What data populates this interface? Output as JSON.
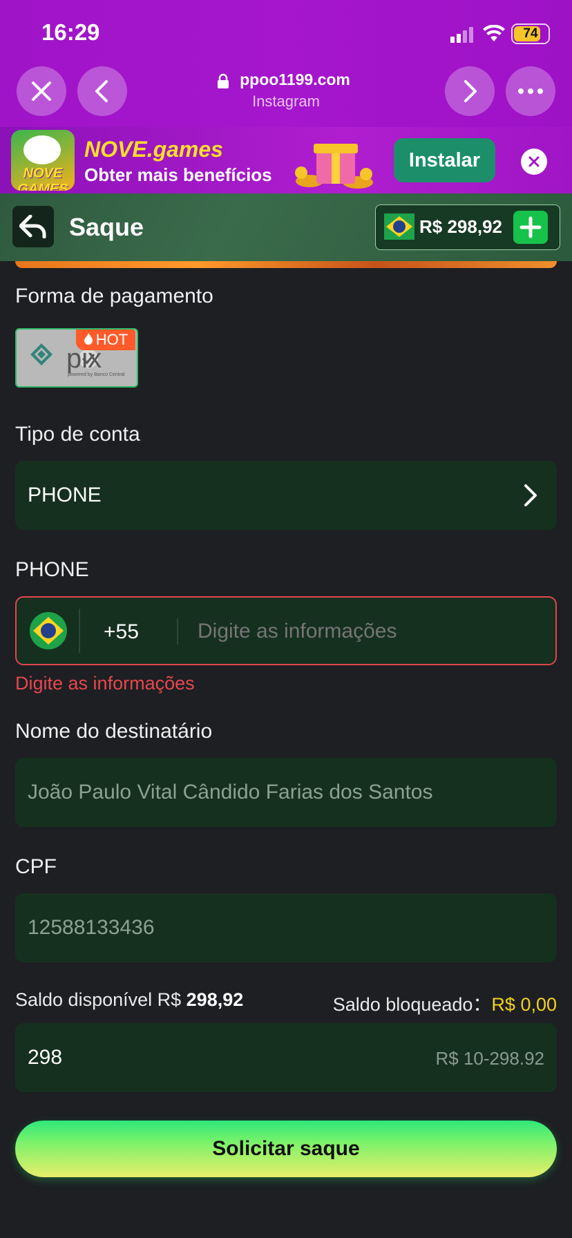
{
  "status_bar": {
    "time": "16:29",
    "battery": "74"
  },
  "browser": {
    "url": "ppoo1199.com",
    "subtitle": "Instagram"
  },
  "banner": {
    "brand": "NOVE.games",
    "tagline": "Obter mais benefícios",
    "install_label": "Instalar",
    "logo_text": "NOVE GAMES"
  },
  "header": {
    "title": "Saque",
    "balance": "R$ 298,92"
  },
  "payment": {
    "label": "Forma de pagamento",
    "method": "pix",
    "method_sub": "powered by Banco Central",
    "hot_badge": "HOT"
  },
  "account_type": {
    "label": "Tipo de conta",
    "value": "PHONE"
  },
  "phone": {
    "label": "PHONE",
    "country_code": "+55",
    "placeholder": "Digite as informações",
    "error": "Digite as informações"
  },
  "recipient": {
    "label": "Nome do destinatário",
    "value": "João Paulo Vital Cândido Farias dos Santos"
  },
  "cpf": {
    "label": "CPF",
    "value": "12588133436"
  },
  "balance_info": {
    "available_label": "Saldo disponível R$ ",
    "available_value": "298,92",
    "blocked_label": "Saldo bloqueado：",
    "blocked_value": "R$ 0,00"
  },
  "amount": {
    "value": "298",
    "range_hint": "R$ 10-298.92"
  },
  "submit_label": "Solicitar saque",
  "colors": {
    "accent_green": "#16c24a",
    "error_red": "#e8474c",
    "blocked_yellow": "#f2d21b",
    "browser_purple": "#a014c8"
  }
}
